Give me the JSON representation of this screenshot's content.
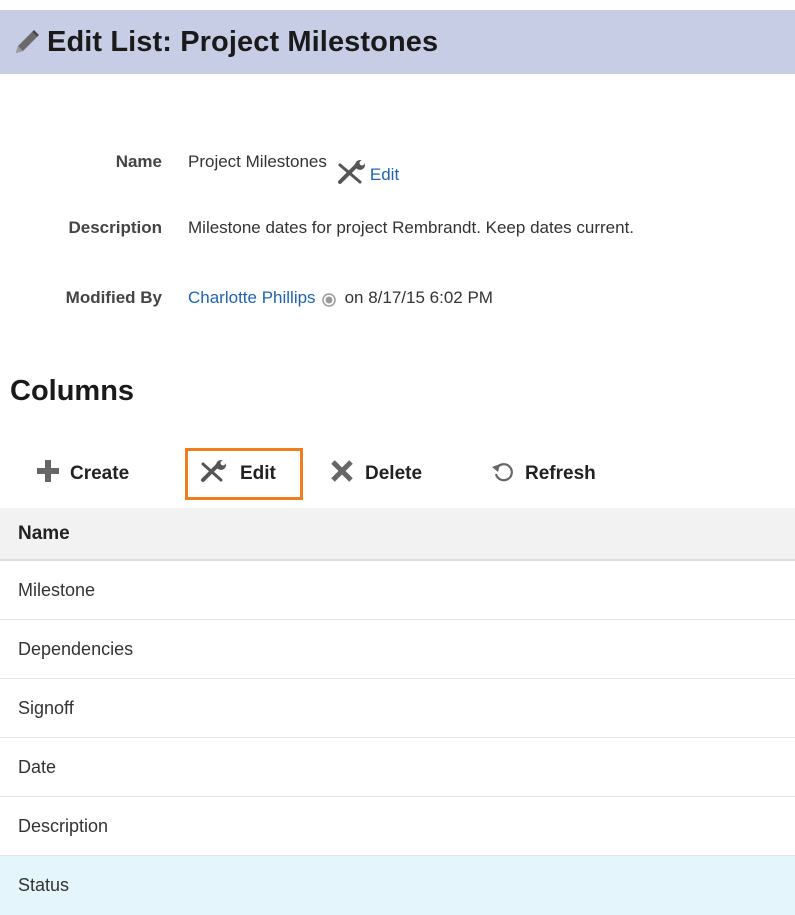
{
  "header": {
    "icon": "pencil-icon",
    "title": "Edit List: Project Milestones"
  },
  "properties": {
    "name": {
      "label": "Name",
      "value": "Project Milestones",
      "edit_icon": "tools-icon",
      "edit_link": "Edit"
    },
    "description": {
      "label": "Description",
      "value": "Milestone dates for project Rembrandt. Keep dates current."
    },
    "modified_by": {
      "label": "Modified By",
      "user": "Charlotte Phillips",
      "presence_icon": "presence-icon",
      "date": "on 8/17/15 6:02 PM"
    }
  },
  "columns_section": {
    "title": "Columns",
    "toolbar": {
      "create": {
        "label": "Create",
        "icon": "plus-icon"
      },
      "edit": {
        "label": "Edit",
        "icon": "tools-icon",
        "highlighted": true
      },
      "delete": {
        "label": "Delete",
        "icon": "x-icon"
      },
      "refresh": {
        "label": "Refresh",
        "icon": "refresh-icon"
      }
    },
    "table": {
      "header": "Name",
      "rows": [
        {
          "name": "Milestone",
          "selected": false
        },
        {
          "name": "Dependencies",
          "selected": false
        },
        {
          "name": "Signoff",
          "selected": false
        },
        {
          "name": "Date",
          "selected": false
        },
        {
          "name": "Description",
          "selected": false
        },
        {
          "name": "Status",
          "selected": true
        }
      ]
    }
  },
  "colors": {
    "header_background": "#c8cde6",
    "link": "#1e64b4",
    "highlight_border": "#f07d1e",
    "selected_row": "#e5f5fc"
  }
}
